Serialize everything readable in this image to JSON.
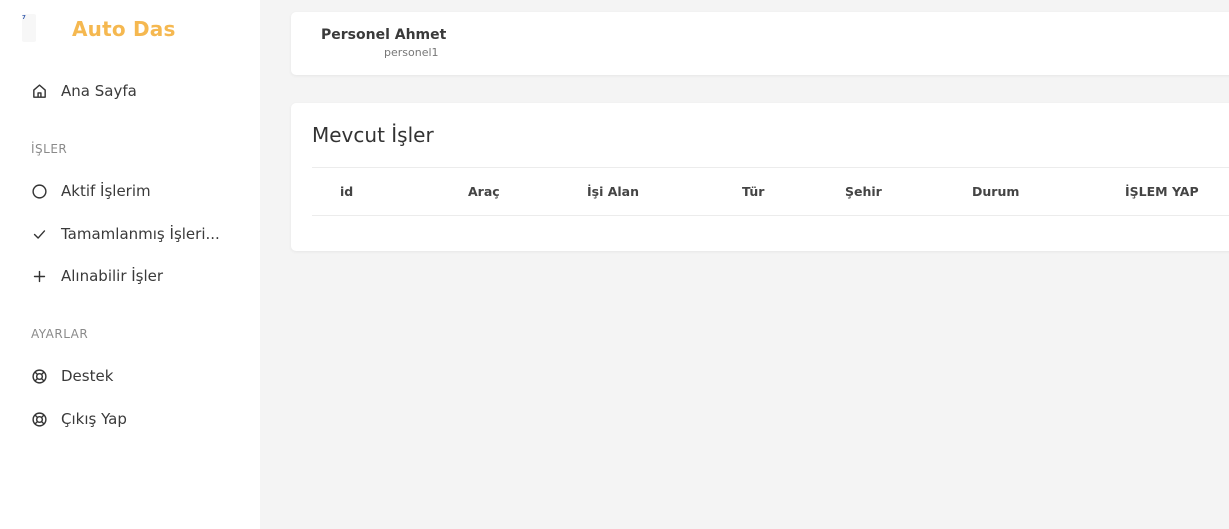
{
  "sidebar": {
    "brand": "Auto Das",
    "items": [
      {
        "label": "Ana Sayfa",
        "icon": "home-icon"
      },
      {
        "label": "Aktif İşlerim",
        "icon": "circle-icon"
      },
      {
        "label": "Tamamlanmış İşleri...",
        "icon": "check-icon"
      },
      {
        "label": "Alınabilir İşler",
        "icon": "plus-icon"
      },
      {
        "label": "Destek",
        "icon": "lifebuoy-icon"
      },
      {
        "label": "Çıkış Yap",
        "icon": "lifebuoy-icon"
      }
    ],
    "sections": {
      "jobs": "İŞLER",
      "settings": "AYARLAR"
    }
  },
  "user": {
    "name": "Personel Ahmet",
    "username": "personel1"
  },
  "jobs": {
    "title": "Mevcut İşler",
    "columns": [
      "id",
      "Araç",
      "İşi Alan",
      "Tür",
      "Şehir",
      "Durum",
      "İŞLEM YAP"
    ],
    "rows": []
  },
  "colors": {
    "brand": "#f5b850",
    "background": "#f4f4f4"
  }
}
